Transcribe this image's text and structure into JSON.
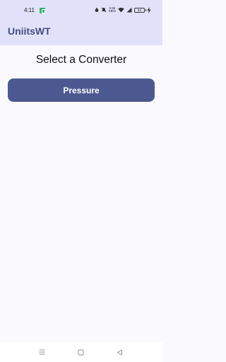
{
  "status_bar": {
    "time": "4:11",
    "network_speed_value": "0.55",
    "network_speed_unit": "KB/S",
    "battery_level": "84",
    "icons": [
      "notification-app-icon",
      "data-saver-icon",
      "do-not-disturb-icon",
      "wifi-icon",
      "signal-icon",
      "battery-icon",
      "charging-icon"
    ]
  },
  "app_bar": {
    "title": "UniitsWT"
  },
  "main": {
    "heading": "Select a Converter",
    "converters": [
      {
        "label": "Pressure"
      }
    ]
  },
  "nav_bar": {
    "icons": [
      "menu-icon",
      "home-icon",
      "back-icon"
    ]
  },
  "colors": {
    "app_bar_background": "#e1e1fa",
    "title_color": "#454c7f",
    "button_background": "#4c5990",
    "page_background": "#faf9fe"
  }
}
